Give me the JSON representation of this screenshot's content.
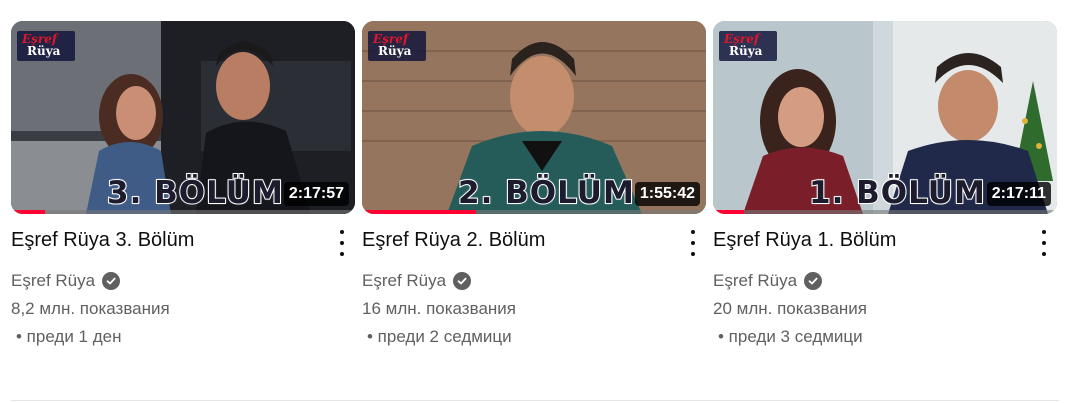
{
  "videos": [
    {
      "title": "Eşref Rüya 3. Bölüm",
      "channel": "Eşref Rüya",
      "views": "8,2 млн. показвания",
      "age": "• преди 1 ден",
      "duration": "2:17:57",
      "episode_label": "3. BÖLÜM",
      "logo_top": "Eşref",
      "logo_bottom": "Rüya",
      "progress": 0.1
    },
    {
      "title": "Eşref Rüya 2. Bölüm",
      "channel": "Eşref Rüya",
      "views": "16 млн. показвания",
      "age": "• преди 2 седмици",
      "duration": "1:55:42",
      "episode_label": "2. BÖLÜM",
      "logo_top": "Eşref",
      "logo_bottom": "Rüya",
      "progress": 0.33
    },
    {
      "title": "Eşref Rüya 1. Bölüm",
      "channel": "Eşref Rüya",
      "views": "20 млн. показвания",
      "age": "• преди 3 седмици",
      "duration": "2:17:11",
      "episode_label": "1. BÖLÜM",
      "logo_top": "Eşref",
      "logo_bottom": "Rüya",
      "progress": 0.09
    }
  ],
  "icons": {
    "verified": "verified-check-icon",
    "menu": "more-vert-icon"
  },
  "colors": {
    "progress": "#ff0033",
    "text_primary": "#0f0f0f",
    "text_secondary": "#606060"
  }
}
